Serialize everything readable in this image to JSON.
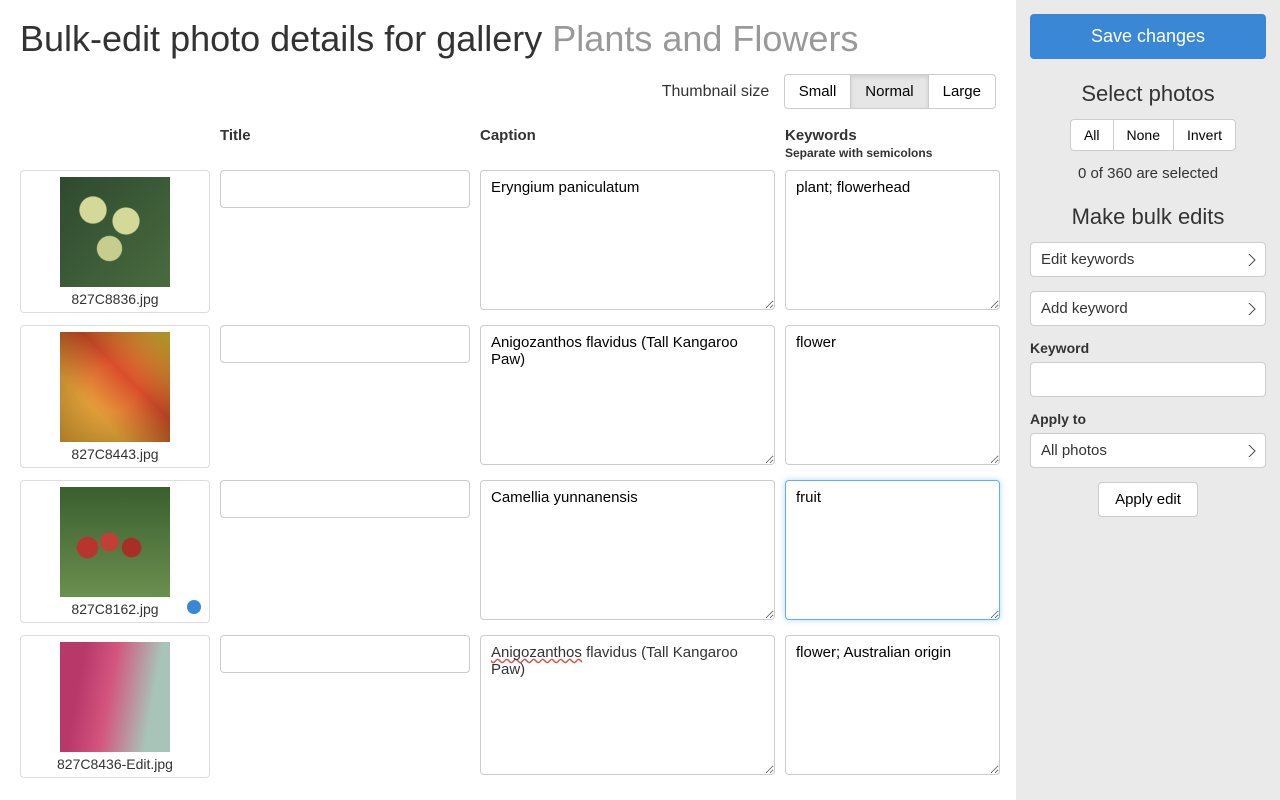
{
  "header": {
    "title": "Bulk-edit photo details for gallery",
    "gallery_name": "Plants and Flowers"
  },
  "thumbnail_size": {
    "label": "Thumbnail size",
    "options": [
      "Small",
      "Normal",
      "Large"
    ],
    "active": "Normal"
  },
  "columns": {
    "title": "Title",
    "caption": "Caption",
    "keywords": "Keywords",
    "keywords_sub": "Separate with semicolons"
  },
  "photos": [
    {
      "filename": "827C8836.jpg",
      "title": "",
      "caption": "Eryngium paniculatum",
      "keywords": "plant; flowerhead",
      "focused": false,
      "dot": false,
      "thumb": "t1"
    },
    {
      "filename": "827C8443.jpg",
      "title": "",
      "caption": "Anigozanthos flavidus (Tall Kangaroo Paw)",
      "keywords": "flower",
      "focused": false,
      "dot": false,
      "thumb": "t2"
    },
    {
      "filename": "827C8162.jpg",
      "title": "",
      "caption": "Camellia yunnanensis",
      "keywords": "fruit",
      "focused": true,
      "dot": true,
      "thumb": "t3"
    },
    {
      "filename": "827C8436-Edit.jpg",
      "title": "",
      "caption": "Anigozanthos flavidus (Tall Kangaroo Paw)",
      "caption_spell": "Anigozanthos",
      "keywords": "flower; Australian origin",
      "focused": false,
      "dot": false,
      "thumb": "t4"
    }
  ],
  "sidebar": {
    "save_label": "Save changes",
    "select": {
      "heading": "Select photos",
      "buttons": [
        "All",
        "None",
        "Invert"
      ],
      "status": "0 of 360 are selected"
    },
    "bulk": {
      "heading": "Make bulk edits",
      "edit_type": "Edit keywords",
      "action": "Add keyword",
      "keyword_label": "Keyword",
      "keyword_value": "",
      "apply_to_label": "Apply to",
      "apply_to": "All photos",
      "apply_button": "Apply edit"
    }
  }
}
